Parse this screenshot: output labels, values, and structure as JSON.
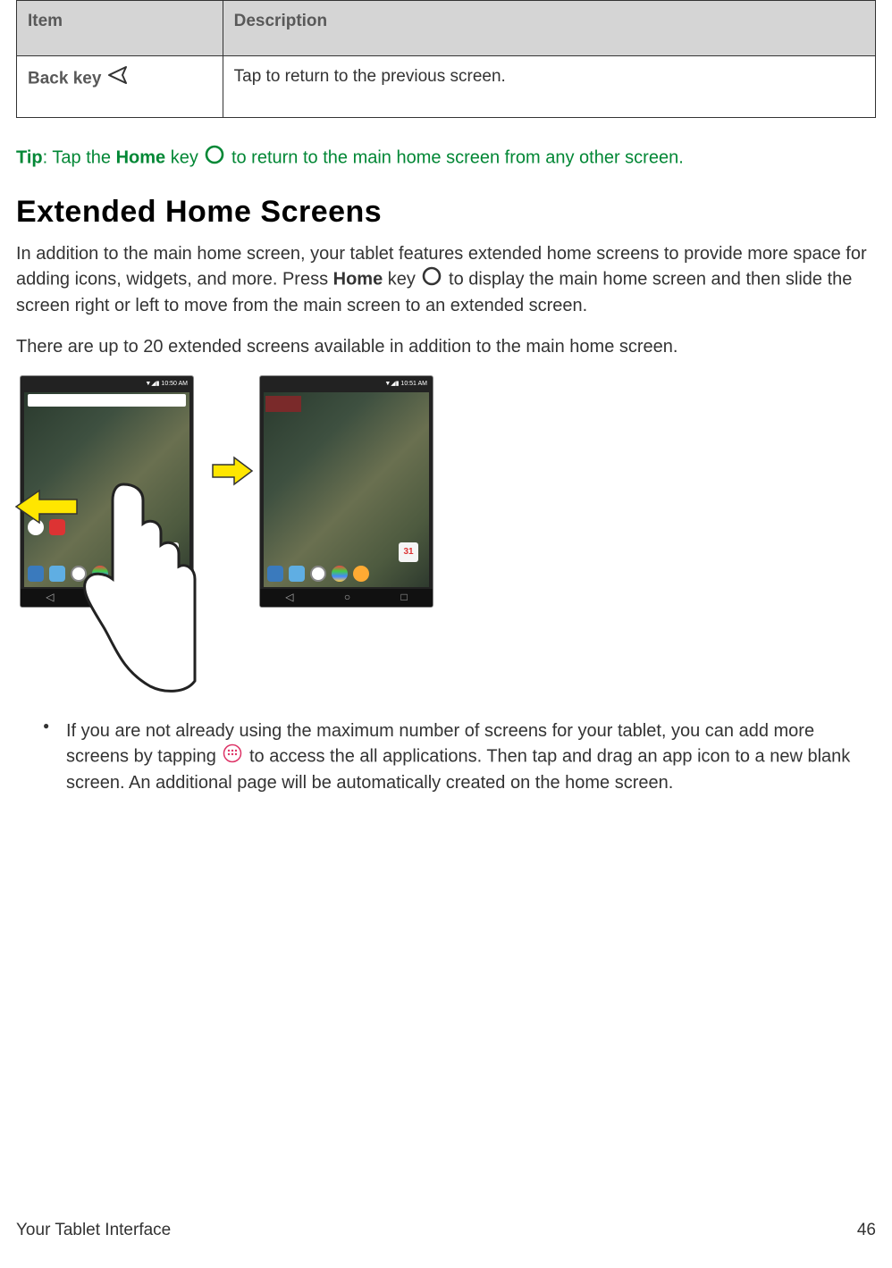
{
  "table": {
    "headers": {
      "item": "Item",
      "description": "Description"
    },
    "row": {
      "item": "Back key",
      "description": "Tap to return to the previous screen."
    }
  },
  "tip": {
    "label": "Tip",
    "prefix": ": Tap the ",
    "home": "Home",
    "mid": " key ",
    "suffix": " to return to the main home screen from any other screen."
  },
  "heading": "Extended Home Screens",
  "para1a": "In addition to the main home screen, your tablet features extended home screens to provide more space for adding icons, widgets, and more. Press ",
  "para1home": "Home",
  "para1b": " key ",
  "para1c": " to display the main home screen and then slide the screen right or left to move from the main screen to an extended screen.",
  "para2": "There are up to 20 extended screens available in addition to the main home screen.",
  "bullet1a": "If you are not already using the maximum number of screens for your tablet, you can add more screens by tapping ",
  "bullet1b": " to access the all applications. Then tap and drag an app icon to a new blank screen. An additional page will be automatically created on the home screen.",
  "statusbar_time1": "▼◢▮ 10:50 AM",
  "statusbar_time2": "▼◢▮ 10:51 AM",
  "calendar_day": "31",
  "footer": {
    "section": "Your Tablet Interface",
    "page": "46"
  }
}
